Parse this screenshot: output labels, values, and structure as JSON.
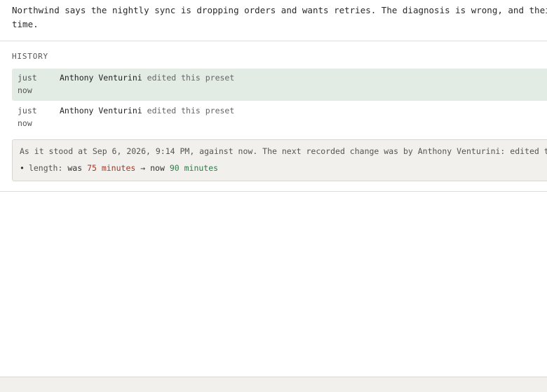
{
  "description": {
    "line1": "Northwind says the nightly sync is dropping orders and wants retries. The diagnosis is wrong, and their",
    "line2": "time."
  },
  "history": {
    "label": "HISTORY",
    "entries": [
      {
        "time_line1": "just",
        "time_line2": "now",
        "author": "Anthony Venturini",
        "action": "edited this preset",
        "selected": true
      },
      {
        "time_line1": "just",
        "time_line2": "now",
        "author": "Anthony Venturini",
        "action": "edited this preset",
        "selected": false
      }
    ]
  },
  "diff": {
    "context": "As it stood at Sep 6, 2026, 9:14 PM, against now. The next recorded change was by Anthony Venturini: edited this preset",
    "changes": [
      {
        "field": "length:",
        "was_label": "was",
        "old_value": "75 minutes",
        "arrow": "→",
        "now_label": "now",
        "new_value": "90 minutes"
      }
    ]
  },
  "colors": {
    "selected_row": "#e2ece5",
    "panel_bg": "#f1f0ec",
    "old_value": "#a13a2e",
    "new_value": "#2f7a4a"
  }
}
